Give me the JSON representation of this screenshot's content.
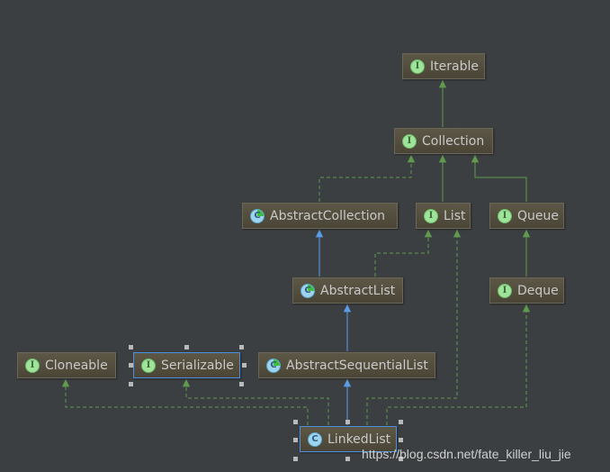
{
  "nodes": {
    "iterable": {
      "label": "Iterable",
      "kind": "interface"
    },
    "collection": {
      "label": "Collection",
      "kind": "interface"
    },
    "abstract_collection": {
      "label": "AbstractCollection",
      "kind": "abstract-class"
    },
    "list": {
      "label": "List",
      "kind": "interface"
    },
    "queue": {
      "label": "Queue",
      "kind": "interface"
    },
    "abstract_list": {
      "label": "AbstractList",
      "kind": "abstract-class"
    },
    "deque": {
      "label": "Deque",
      "kind": "interface"
    },
    "cloneable": {
      "label": "Cloneable",
      "kind": "interface"
    },
    "serializable": {
      "label": "Serializable",
      "kind": "interface",
      "selected": true
    },
    "abstract_sequential_list": {
      "label": "AbstractSequentialList",
      "kind": "abstract-class"
    },
    "linked_list": {
      "label": "LinkedList",
      "kind": "class",
      "selected": true
    }
  },
  "icons": {
    "interface": "I",
    "class": "C"
  },
  "edges": [
    {
      "from": "Collection",
      "to": "Iterable",
      "type": "extends-interface"
    },
    {
      "from": "AbstractCollection",
      "to": "Collection",
      "type": "implements"
    },
    {
      "from": "List",
      "to": "Collection",
      "type": "extends-interface"
    },
    {
      "from": "Queue",
      "to": "Collection",
      "type": "extends-interface"
    },
    {
      "from": "AbstractList",
      "to": "AbstractCollection",
      "type": "extends"
    },
    {
      "from": "AbstractList",
      "to": "List",
      "type": "implements"
    },
    {
      "from": "Deque",
      "to": "Queue",
      "type": "extends-interface"
    },
    {
      "from": "AbstractSequentialList",
      "to": "AbstractList",
      "type": "extends"
    },
    {
      "from": "LinkedList",
      "to": "AbstractSequentialList",
      "type": "extends"
    },
    {
      "from": "LinkedList",
      "to": "Cloneable",
      "type": "implements"
    },
    {
      "from": "LinkedList",
      "to": "Serializable",
      "type": "implements"
    },
    {
      "from": "LinkedList",
      "to": "List",
      "type": "implements"
    },
    {
      "from": "LinkedList",
      "to": "Deque",
      "type": "implements"
    }
  ],
  "colors": {
    "background": "#3c3f41",
    "extends": "#5a9ce8",
    "implements": "#5f9a4e"
  },
  "watermark": "https://blog.csdn.net/fate_killer_liu_jie"
}
